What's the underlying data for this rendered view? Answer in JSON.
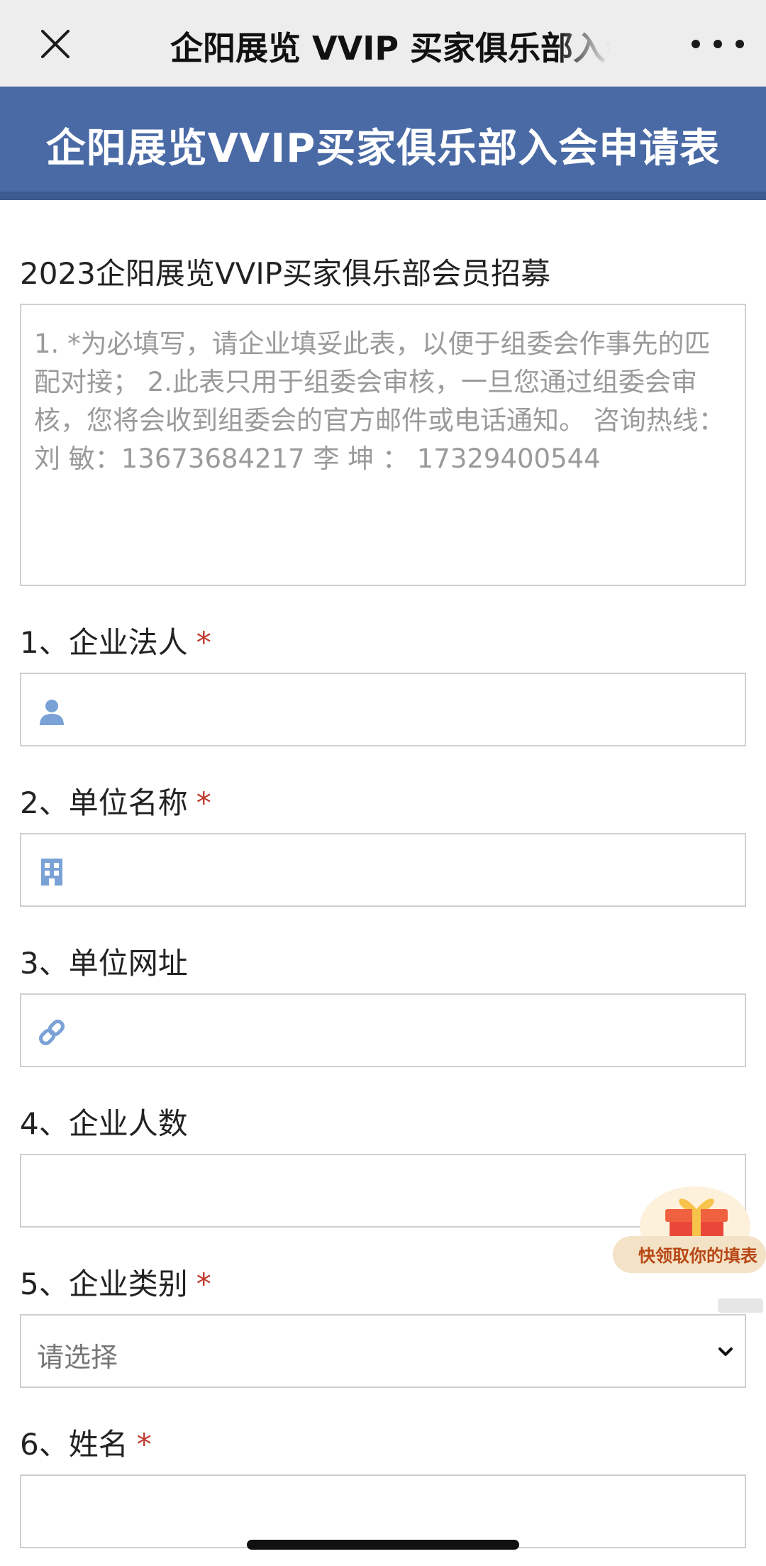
{
  "topbar": {
    "title": "企阳展览 VVIP 买家俱乐部入会"
  },
  "banner": {
    "title": "企阳展览VVIP买家俱乐部入会申请表"
  },
  "intro": {
    "title": "2023企阳展览VVIP买家俱乐部会员招募",
    "text": "1. *为必填写，请企业填妥此表，以便于组委会作事先的匹配对接； 2.此表只用于组委会审核，一旦您通过组委会审核，您将会收到组委会的官方邮件或电话通知。 咨询热线：刘 敏：13673684217 李 坤 ： 17329400544"
  },
  "questions": [
    {
      "label": "1、企业法人",
      "required": "*",
      "icon": "person-icon",
      "value": ""
    },
    {
      "label": "2、单位名称",
      "required": "*",
      "icon": "building-icon",
      "value": ""
    },
    {
      "label": "3、单位网址",
      "required": "",
      "icon": "link-icon",
      "value": ""
    },
    {
      "label": "4、企业人数",
      "required": "",
      "icon": "",
      "value": ""
    },
    {
      "label": "5、企业类别",
      "required": "*",
      "icon": "",
      "selected": "请选择"
    },
    {
      "label": "6、姓名",
      "required": "*",
      "icon": "",
      "value": ""
    }
  ],
  "promo": {
    "text": "快领取你的填表"
  },
  "colors": {
    "banner": "#4a6aa5",
    "required": "#c0392b",
    "icon": "#7aa2d6"
  }
}
